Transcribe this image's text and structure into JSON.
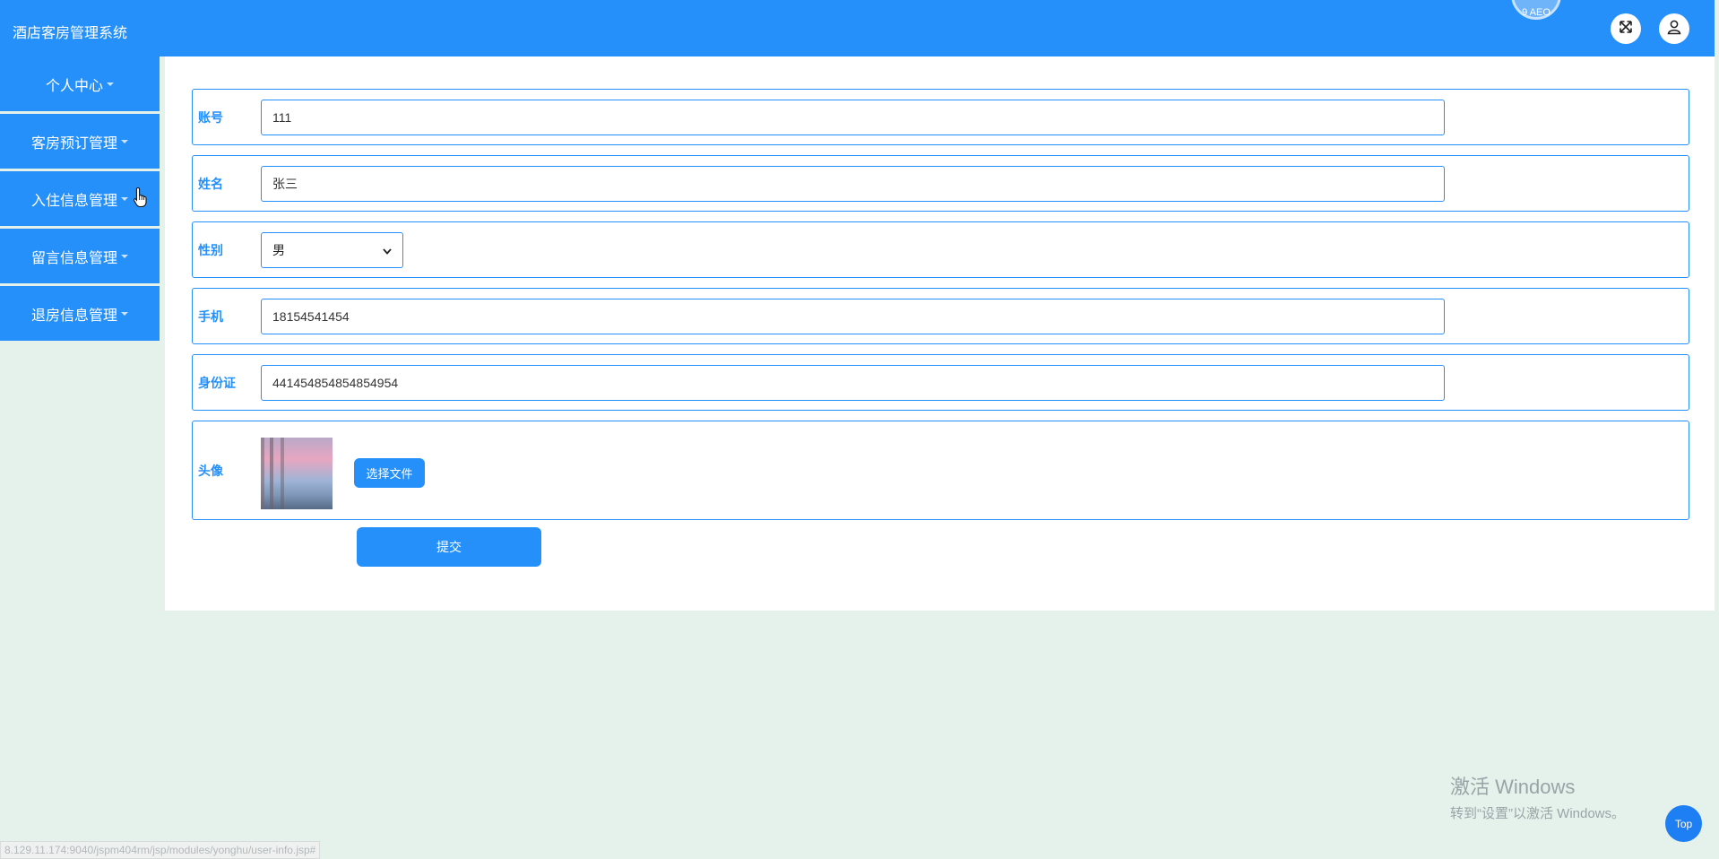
{
  "header": {
    "app_title": "酒店客房管理系统",
    "circle_text": "9 AEO"
  },
  "sidebar": {
    "items": [
      {
        "label": "个人中心"
      },
      {
        "label": "客房预订管理"
      },
      {
        "label": "入住信息管理"
      },
      {
        "label": "留言信息管理"
      },
      {
        "label": "退房信息管理"
      }
    ]
  },
  "form": {
    "account": {
      "label": "账号",
      "value": "111"
    },
    "name": {
      "label": "姓名",
      "value": "张三"
    },
    "gender": {
      "label": "性别",
      "selected": "男"
    },
    "phone": {
      "label": "手机",
      "value": "18154541454"
    },
    "id_card": {
      "label": "身份证",
      "value": "441454854854854954"
    },
    "avatar": {
      "label": "头像",
      "choose_file_label": "选择文件"
    },
    "submit_label": "提交"
  },
  "watermark": {
    "title": "激活 Windows",
    "subtitle": "转到“设置”以激活 Windows。"
  },
  "top_button_label": "Top",
  "status_url": "8.129.11.174:9040/jspm404rm/jsp/modules/yonghu/user-info.jsp#",
  "colors": {
    "primary": "#2590fa",
    "background": "#e5f2ec"
  }
}
